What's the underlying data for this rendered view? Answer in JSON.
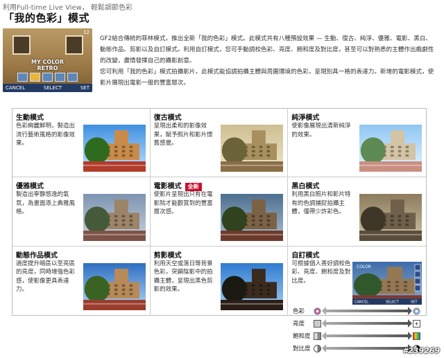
{
  "top_line": "利用Full-time Live View， 輕鬆調節色彩",
  "title": "「我的色彩」模式",
  "lcd": {
    "caption_line1": "MY COLOR",
    "caption_line2": "RETRO",
    "frame_number": "12",
    "cancel_label": "CANCEL",
    "select_label": "SELECT",
    "set_label": "SET"
  },
  "description": {
    "p1": "GF2結合傳統的菲林模式，推出全新「我的色彩」模式。此模式共有八種預設效果 — 生動、復古、純淨、優雅、電影、黑白、動態作品、剪影以及自訂模式。利用自訂模式，您可手動調校色彩、亮度、飽和度及對比度，甚至可以對熟悉的主體作出戲劇性的改變，盡情發揮自己的攝影創意。",
    "p2": "您可利用「我的色彩」模式拍攝影片，此模式能協調拍攝主體與周圍環境的色彩，呈現別具一格的表達力。新增的電影模式，使影片展現出電影一般的豐富層次。"
  },
  "modes": [
    {
      "title": "生動模式",
      "text": "色彩絢麗鮮明，製造出流行藝術風格的影像效果。",
      "badge": "",
      "tint": "vivid"
    },
    {
      "title": "復古模式",
      "text": "呈現出柔和的影像效果，賦予照片和影片懷舊感覺。",
      "badge": "",
      "tint": "retro"
    },
    {
      "title": "純淨模式",
      "text": "使影像展現出清新純淨的效果。",
      "badge": "",
      "tint": "pure"
    },
    {
      "title": "優雅模式",
      "text": "製造出寧靜悠逸的氣氛，為畫面添上典雅風格。",
      "badge": "",
      "tint": "elegant"
    },
    {
      "title": "電影模式",
      "text": "使影片呈現出只有在電影院才能觀賞到的豐富層次感。",
      "badge": "全新",
      "tint": "cinema"
    },
    {
      "title": "黑白模式",
      "text": "利用黑白照片和影片特有的色調捕捉拍攝主體，僅帶少許彩色。",
      "badge": "",
      "tint": "mono"
    },
    {
      "title": "動態作品模式",
      "text": "適度提升暗區以至亮區的亮度，同時增強色彩感，使影像更具表達力。",
      "badge": "",
      "tint": "dynamic"
    },
    {
      "title": "剪影模式",
      "text": "利用天空或落日等背景色彩，突顯陰影中的拍攝主體，呈現出黑色剪影的效果。",
      "badge": "",
      "tint": "silhouette"
    },
    {
      "title": "自訂模式",
      "text": "可根據個人喜好調校色彩、亮度、飽和度及對比度。",
      "badge": "",
      "tint": "custom"
    }
  ],
  "custom_screen": {
    "label": "COLOR",
    "cancel": "CANCEL",
    "select": "SELECT",
    "set": "SET"
  },
  "adjustments": [
    {
      "label": "色彩",
      "icon_left": "color-wheel-icon",
      "icon_right": "color-wheel-icon"
    },
    {
      "label": "亮度",
      "icon_left": "square-icon",
      "icon_right": "plus-icon"
    },
    {
      "label": "飽和度",
      "icon_left": "half-square-icon",
      "icon_right": "rainbow-square-icon"
    },
    {
      "label": "對比度",
      "icon_left": "half-circle-icon",
      "icon_right": "half-circle-icon"
    }
  ],
  "watermark": "#239269",
  "colors": {
    "badge": "#c8102e",
    "lcd_bar": "#233a63"
  }
}
